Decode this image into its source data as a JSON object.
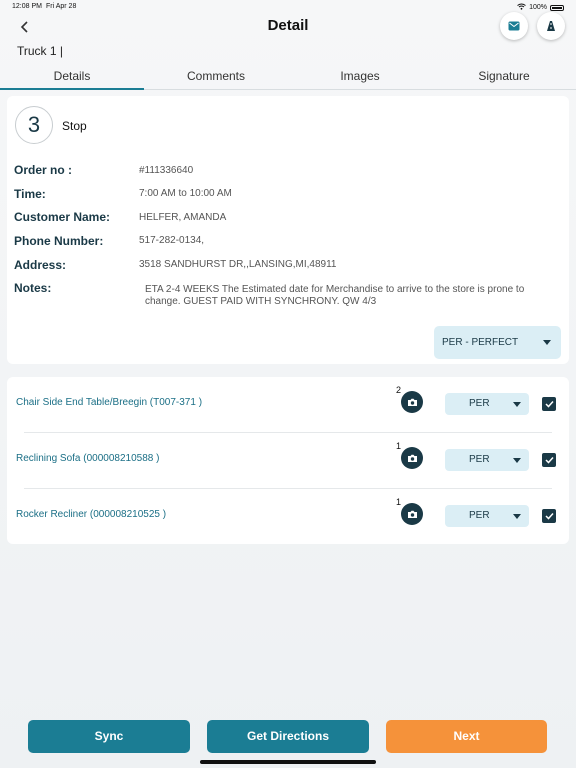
{
  "status_bar": {
    "time": "12:08 PM",
    "date": "Fri Apr 28",
    "battery": "100%"
  },
  "header": {
    "title": "Detail",
    "truck": "Truck 1 |"
  },
  "tabs": [
    {
      "label": "Details"
    },
    {
      "label": "Comments"
    },
    {
      "label": "Images"
    },
    {
      "label": "Signature"
    }
  ],
  "stop": {
    "number": "3",
    "label": "Stop",
    "fields": {
      "order_label": "Order no :",
      "order_value": "#111336640",
      "time_label": "Time:",
      "time_value": "7:00 AM to 10:00 AM",
      "customer_label": "Customer Name:",
      "customer_value": "HELFER, AMANDA",
      "phone_label": "Phone Number:",
      "phone_value": "517-282-0134,",
      "address_label": "Address:",
      "address_value": "3518 SANDHURST DR,,LANSING,MI,48911",
      "notes_label": "Notes:",
      "notes_value": "ETA 2-4 WEEKS The Estimated date for Merchandise to arrive to the store is prone to change. GUEST PAID WITH SYNCHRONY. QW 4/3"
    },
    "status_value": "PER - PERFECT"
  },
  "items": [
    {
      "name": "Chair Side End Table/Breegin (T007-371 )",
      "photo_count": "2",
      "status": "PER"
    },
    {
      "name": "Reclining Sofa (000008210588 )",
      "photo_count": "1",
      "status": "PER"
    },
    {
      "name": "Rocker Recliner (000008210525 )",
      "photo_count": "1",
      "status": "PER"
    }
  ],
  "buttons": {
    "sync": "Sync",
    "directions": "Get Directions",
    "next": "Next"
  },
  "colors": {
    "primary": "#1b7d94",
    "dark": "#1a3946",
    "accent": "#f5923a",
    "select_bg": "#dbeef5"
  },
  "icons": {
    "back": "chevron-left-icon",
    "mail": "mail-icon",
    "navigate": "navigation-icon",
    "camera": "camera-icon",
    "check": "checkbox-checked-icon"
  }
}
